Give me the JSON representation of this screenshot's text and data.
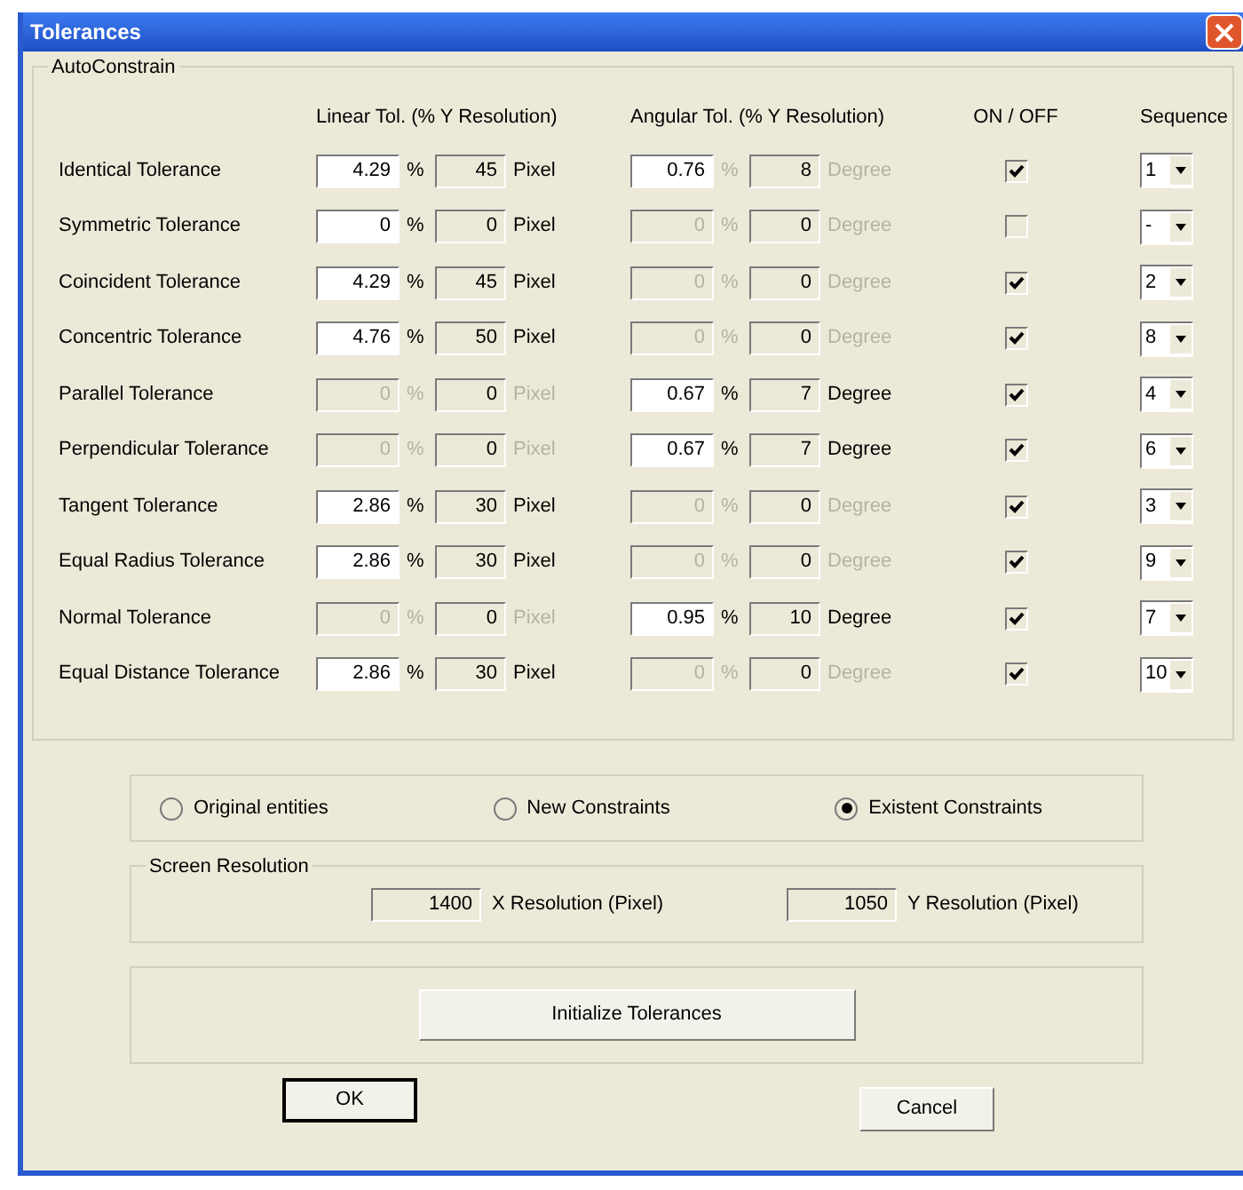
{
  "window": {
    "title": "Tolerances"
  },
  "autoconstrain": {
    "title": "AutoConstrain",
    "headers": {
      "linear": "Linear Tol. (% Y Resolution)",
      "angular": "Angular Tol. (% Y Resolution)",
      "onoff": "ON / OFF",
      "sequence": "Sequence"
    },
    "rows": [
      {
        "label": "Identical Tolerance",
        "linear": {
          "percent": "4.29",
          "editable": true,
          "active": true,
          "unit_symbol": "%",
          "value": "45",
          "unit": "Pixel"
        },
        "angular": {
          "percent": "0.76",
          "editable": true,
          "active": false,
          "unit_symbol": "%",
          "value": "8",
          "unit": "Degree"
        },
        "checked": true,
        "sequence": "1"
      },
      {
        "label": "Symmetric Tolerance",
        "linear": {
          "percent": "0",
          "editable": true,
          "active": true,
          "unit_symbol": "%",
          "value": "0",
          "unit": "Pixel"
        },
        "angular": {
          "percent": "0",
          "editable": false,
          "active": false,
          "unit_symbol": "%",
          "value": "0",
          "unit": "Degree"
        },
        "checked": false,
        "sequence": "-"
      },
      {
        "label": "Coincident Tolerance",
        "linear": {
          "percent": "4.29",
          "editable": true,
          "active": true,
          "unit_symbol": "%",
          "value": "45",
          "unit": "Pixel"
        },
        "angular": {
          "percent": "0",
          "editable": false,
          "active": false,
          "unit_symbol": "%",
          "value": "0",
          "unit": "Degree"
        },
        "checked": true,
        "sequence": "2"
      },
      {
        "label": "Concentric Tolerance",
        "linear": {
          "percent": "4.76",
          "editable": true,
          "active": true,
          "unit_symbol": "%",
          "value": "50",
          "unit": "Pixel"
        },
        "angular": {
          "percent": "0",
          "editable": false,
          "active": false,
          "unit_symbol": "%",
          "value": "0",
          "unit": "Degree"
        },
        "checked": true,
        "sequence": "8"
      },
      {
        "label": "Parallel Tolerance",
        "linear": {
          "percent": "0",
          "editable": false,
          "active": false,
          "unit_symbol": "%",
          "value": "0",
          "unit": "Pixel"
        },
        "angular": {
          "percent": "0.67",
          "editable": true,
          "active": true,
          "unit_symbol": "%",
          "value": "7",
          "unit": "Degree"
        },
        "checked": true,
        "sequence": "4"
      },
      {
        "label": "Perpendicular Tolerance",
        "linear": {
          "percent": "0",
          "editable": false,
          "active": false,
          "unit_symbol": "%",
          "value": "0",
          "unit": "Pixel"
        },
        "angular": {
          "percent": "0.67",
          "editable": true,
          "active": true,
          "unit_symbol": "%",
          "value": "7",
          "unit": "Degree"
        },
        "checked": true,
        "sequence": "6"
      },
      {
        "label": "Tangent Tolerance",
        "linear": {
          "percent": "2.86",
          "editable": true,
          "active": true,
          "unit_symbol": "%",
          "value": "30",
          "unit": "Pixel"
        },
        "angular": {
          "percent": "0",
          "editable": false,
          "active": false,
          "unit_symbol": "%",
          "value": "0",
          "unit": "Degree"
        },
        "checked": true,
        "sequence": "3"
      },
      {
        "label": "Equal Radius Tolerance",
        "linear": {
          "percent": "2.86",
          "editable": true,
          "active": true,
          "unit_symbol": "%",
          "value": "30",
          "unit": "Pixel"
        },
        "angular": {
          "percent": "0",
          "editable": false,
          "active": false,
          "unit_symbol": "%",
          "value": "0",
          "unit": "Degree"
        },
        "checked": true,
        "sequence": "9"
      },
      {
        "label": "Normal Tolerance",
        "linear": {
          "percent": "0",
          "editable": false,
          "active": false,
          "unit_symbol": "%",
          "value": "0",
          "unit": "Pixel"
        },
        "angular": {
          "percent": "0.95",
          "editable": true,
          "active": true,
          "unit_symbol": "%",
          "value": "10",
          "unit": "Degree"
        },
        "checked": true,
        "sequence": "7"
      },
      {
        "label": "Equal Distance Tolerance",
        "linear": {
          "percent": "2.86",
          "editable": true,
          "active": true,
          "unit_symbol": "%",
          "value": "30",
          "unit": "Pixel"
        },
        "angular": {
          "percent": "0",
          "editable": false,
          "active": false,
          "unit_symbol": "%",
          "value": "0",
          "unit": "Degree"
        },
        "checked": true,
        "sequence": "10"
      }
    ]
  },
  "radios": [
    {
      "label": "Original entities",
      "selected": false
    },
    {
      "label": "New Constraints",
      "selected": false
    },
    {
      "label": "Existent Constraints",
      "selected": true
    }
  ],
  "screen_resolution": {
    "title": "Screen Resolution",
    "x_value": "1400",
    "x_label": "X Resolution (Pixel)",
    "y_value": "1050",
    "y_label": "Y Resolution (Pixel)"
  },
  "initialize_button": "Initialize Tolerances",
  "buttons": [
    {
      "label": "OK",
      "default": true
    },
    {
      "label": "Cancel",
      "default": false
    }
  ]
}
